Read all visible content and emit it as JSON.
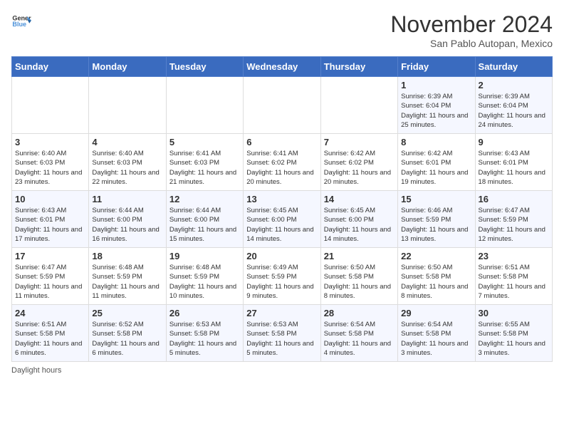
{
  "logo": {
    "general": "General",
    "blue": "Blue"
  },
  "title": "November 2024",
  "subtitle": "San Pablo Autopan, Mexico",
  "days_of_week": [
    "Sunday",
    "Monday",
    "Tuesday",
    "Wednesday",
    "Thursday",
    "Friday",
    "Saturday"
  ],
  "footer": "Daylight hours",
  "weeks": [
    [
      {
        "day": "",
        "info": ""
      },
      {
        "day": "",
        "info": ""
      },
      {
        "day": "",
        "info": ""
      },
      {
        "day": "",
        "info": ""
      },
      {
        "day": "",
        "info": ""
      },
      {
        "day": "1",
        "info": "Sunrise: 6:39 AM\nSunset: 6:04 PM\nDaylight: 11 hours and 25 minutes."
      },
      {
        "day": "2",
        "info": "Sunrise: 6:39 AM\nSunset: 6:04 PM\nDaylight: 11 hours and 24 minutes."
      }
    ],
    [
      {
        "day": "3",
        "info": "Sunrise: 6:40 AM\nSunset: 6:03 PM\nDaylight: 11 hours and 23 minutes."
      },
      {
        "day": "4",
        "info": "Sunrise: 6:40 AM\nSunset: 6:03 PM\nDaylight: 11 hours and 22 minutes."
      },
      {
        "day": "5",
        "info": "Sunrise: 6:41 AM\nSunset: 6:03 PM\nDaylight: 11 hours and 21 minutes."
      },
      {
        "day": "6",
        "info": "Sunrise: 6:41 AM\nSunset: 6:02 PM\nDaylight: 11 hours and 20 minutes."
      },
      {
        "day": "7",
        "info": "Sunrise: 6:42 AM\nSunset: 6:02 PM\nDaylight: 11 hours and 20 minutes."
      },
      {
        "day": "8",
        "info": "Sunrise: 6:42 AM\nSunset: 6:01 PM\nDaylight: 11 hours and 19 minutes."
      },
      {
        "day": "9",
        "info": "Sunrise: 6:43 AM\nSunset: 6:01 PM\nDaylight: 11 hours and 18 minutes."
      }
    ],
    [
      {
        "day": "10",
        "info": "Sunrise: 6:43 AM\nSunset: 6:01 PM\nDaylight: 11 hours and 17 minutes."
      },
      {
        "day": "11",
        "info": "Sunrise: 6:44 AM\nSunset: 6:00 PM\nDaylight: 11 hours and 16 minutes."
      },
      {
        "day": "12",
        "info": "Sunrise: 6:44 AM\nSunset: 6:00 PM\nDaylight: 11 hours and 15 minutes."
      },
      {
        "day": "13",
        "info": "Sunrise: 6:45 AM\nSunset: 6:00 PM\nDaylight: 11 hours and 14 minutes."
      },
      {
        "day": "14",
        "info": "Sunrise: 6:45 AM\nSunset: 6:00 PM\nDaylight: 11 hours and 14 minutes."
      },
      {
        "day": "15",
        "info": "Sunrise: 6:46 AM\nSunset: 5:59 PM\nDaylight: 11 hours and 13 minutes."
      },
      {
        "day": "16",
        "info": "Sunrise: 6:47 AM\nSunset: 5:59 PM\nDaylight: 11 hours and 12 minutes."
      }
    ],
    [
      {
        "day": "17",
        "info": "Sunrise: 6:47 AM\nSunset: 5:59 PM\nDaylight: 11 hours and 11 minutes."
      },
      {
        "day": "18",
        "info": "Sunrise: 6:48 AM\nSunset: 5:59 PM\nDaylight: 11 hours and 11 minutes."
      },
      {
        "day": "19",
        "info": "Sunrise: 6:48 AM\nSunset: 5:59 PM\nDaylight: 11 hours and 10 minutes."
      },
      {
        "day": "20",
        "info": "Sunrise: 6:49 AM\nSunset: 5:59 PM\nDaylight: 11 hours and 9 minutes."
      },
      {
        "day": "21",
        "info": "Sunrise: 6:50 AM\nSunset: 5:58 PM\nDaylight: 11 hours and 8 minutes."
      },
      {
        "day": "22",
        "info": "Sunrise: 6:50 AM\nSunset: 5:58 PM\nDaylight: 11 hours and 8 minutes."
      },
      {
        "day": "23",
        "info": "Sunrise: 6:51 AM\nSunset: 5:58 PM\nDaylight: 11 hours and 7 minutes."
      }
    ],
    [
      {
        "day": "24",
        "info": "Sunrise: 6:51 AM\nSunset: 5:58 PM\nDaylight: 11 hours and 6 minutes."
      },
      {
        "day": "25",
        "info": "Sunrise: 6:52 AM\nSunset: 5:58 PM\nDaylight: 11 hours and 6 minutes."
      },
      {
        "day": "26",
        "info": "Sunrise: 6:53 AM\nSunset: 5:58 PM\nDaylight: 11 hours and 5 minutes."
      },
      {
        "day": "27",
        "info": "Sunrise: 6:53 AM\nSunset: 5:58 PM\nDaylight: 11 hours and 5 minutes."
      },
      {
        "day": "28",
        "info": "Sunrise: 6:54 AM\nSunset: 5:58 PM\nDaylight: 11 hours and 4 minutes."
      },
      {
        "day": "29",
        "info": "Sunrise: 6:54 AM\nSunset: 5:58 PM\nDaylight: 11 hours and 3 minutes."
      },
      {
        "day": "30",
        "info": "Sunrise: 6:55 AM\nSunset: 5:58 PM\nDaylight: 11 hours and 3 minutes."
      }
    ]
  ]
}
